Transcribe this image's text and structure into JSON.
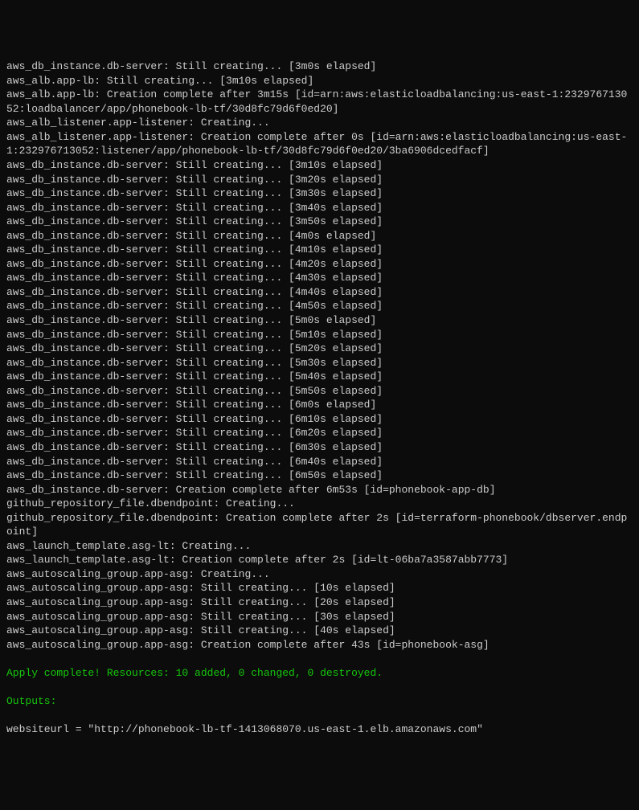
{
  "lines": [
    {
      "text": "aws_db_instance.db-server: Still creating... [3m0s elapsed]",
      "class": ""
    },
    {
      "text": "aws_alb.app-lb: Still creating... [3m10s elapsed]",
      "class": ""
    },
    {
      "text": "aws_alb.app-lb: Creation complete after 3m15s [id=arn:aws:elasticloadbalancing:us-east-1:232976713052:loadbalancer/app/phonebook-lb-tf/30d8fc79d6f0ed20]",
      "class": ""
    },
    {
      "text": "aws_alb_listener.app-listener: Creating...",
      "class": ""
    },
    {
      "text": "aws_alb_listener.app-listener: Creation complete after 0s [id=arn:aws:elasticloadbalancing:us-east-1:232976713052:listener/app/phonebook-lb-tf/30d8fc79d6f0ed20/3ba6906dcedfacf]",
      "class": ""
    },
    {
      "text": "aws_db_instance.db-server: Still creating... [3m10s elapsed]",
      "class": ""
    },
    {
      "text": "aws_db_instance.db-server: Still creating... [3m20s elapsed]",
      "class": ""
    },
    {
      "text": "aws_db_instance.db-server: Still creating... [3m30s elapsed]",
      "class": ""
    },
    {
      "text": "aws_db_instance.db-server: Still creating... [3m40s elapsed]",
      "class": ""
    },
    {
      "text": "aws_db_instance.db-server: Still creating... [3m50s elapsed]",
      "class": ""
    },
    {
      "text": "aws_db_instance.db-server: Still creating... [4m0s elapsed]",
      "class": ""
    },
    {
      "text": "aws_db_instance.db-server: Still creating... [4m10s elapsed]",
      "class": ""
    },
    {
      "text": "aws_db_instance.db-server: Still creating... [4m20s elapsed]",
      "class": ""
    },
    {
      "text": "aws_db_instance.db-server: Still creating... [4m30s elapsed]",
      "class": ""
    },
    {
      "text": "aws_db_instance.db-server: Still creating... [4m40s elapsed]",
      "class": ""
    },
    {
      "text": "aws_db_instance.db-server: Still creating... [4m50s elapsed]",
      "class": ""
    },
    {
      "text": "aws_db_instance.db-server: Still creating... [5m0s elapsed]",
      "class": ""
    },
    {
      "text": "aws_db_instance.db-server: Still creating... [5m10s elapsed]",
      "class": ""
    },
    {
      "text": "aws_db_instance.db-server: Still creating... [5m20s elapsed]",
      "class": ""
    },
    {
      "text": "aws_db_instance.db-server: Still creating... [5m30s elapsed]",
      "class": ""
    },
    {
      "text": "aws_db_instance.db-server: Still creating... [5m40s elapsed]",
      "class": ""
    },
    {
      "text": "aws_db_instance.db-server: Still creating... [5m50s elapsed]",
      "class": ""
    },
    {
      "text": "aws_db_instance.db-server: Still creating... [6m0s elapsed]",
      "class": ""
    },
    {
      "text": "aws_db_instance.db-server: Still creating... [6m10s elapsed]",
      "class": ""
    },
    {
      "text": "aws_db_instance.db-server: Still creating... [6m20s elapsed]",
      "class": ""
    },
    {
      "text": "aws_db_instance.db-server: Still creating... [6m30s elapsed]",
      "class": ""
    },
    {
      "text": "aws_db_instance.db-server: Still creating... [6m40s elapsed]",
      "class": ""
    },
    {
      "text": "aws_db_instance.db-server: Still creating... [6m50s elapsed]",
      "class": ""
    },
    {
      "text": "aws_db_instance.db-server: Creation complete after 6m53s [id=phonebook-app-db]",
      "class": ""
    },
    {
      "text": "github_repository_file.dbendpoint: Creating...",
      "class": ""
    },
    {
      "text": "github_repository_file.dbendpoint: Creation complete after 2s [id=terraform-phonebook/dbserver.endpoint]",
      "class": ""
    },
    {
      "text": "aws_launch_template.asg-lt: Creating...",
      "class": ""
    },
    {
      "text": "aws_launch_template.asg-lt: Creation complete after 2s [id=lt-06ba7a3587abb7773]",
      "class": ""
    },
    {
      "text": "aws_autoscaling_group.app-asg: Creating...",
      "class": ""
    },
    {
      "text": "aws_autoscaling_group.app-asg: Still creating... [10s elapsed]",
      "class": ""
    },
    {
      "text": "aws_autoscaling_group.app-asg: Still creating... [20s elapsed]",
      "class": ""
    },
    {
      "text": "aws_autoscaling_group.app-asg: Still creating... [30s elapsed]",
      "class": ""
    },
    {
      "text": "aws_autoscaling_group.app-asg: Still creating... [40s elapsed]",
      "class": ""
    },
    {
      "text": "aws_autoscaling_group.app-asg: Creation complete after 43s [id=phonebook-asg]",
      "class": ""
    },
    {
      "text": "",
      "class": "blank"
    },
    {
      "text": "Apply complete! Resources: 10 added, 0 changed, 0 destroyed.",
      "class": "green"
    },
    {
      "text": "",
      "class": "blank"
    },
    {
      "text": "Outputs:",
      "class": "green"
    },
    {
      "text": "",
      "class": "blank"
    },
    {
      "text": "websiteurl = \"http://phonebook-lb-tf-1413068070.us-east-1.elb.amazonaws.com\"",
      "class": ""
    }
  ]
}
